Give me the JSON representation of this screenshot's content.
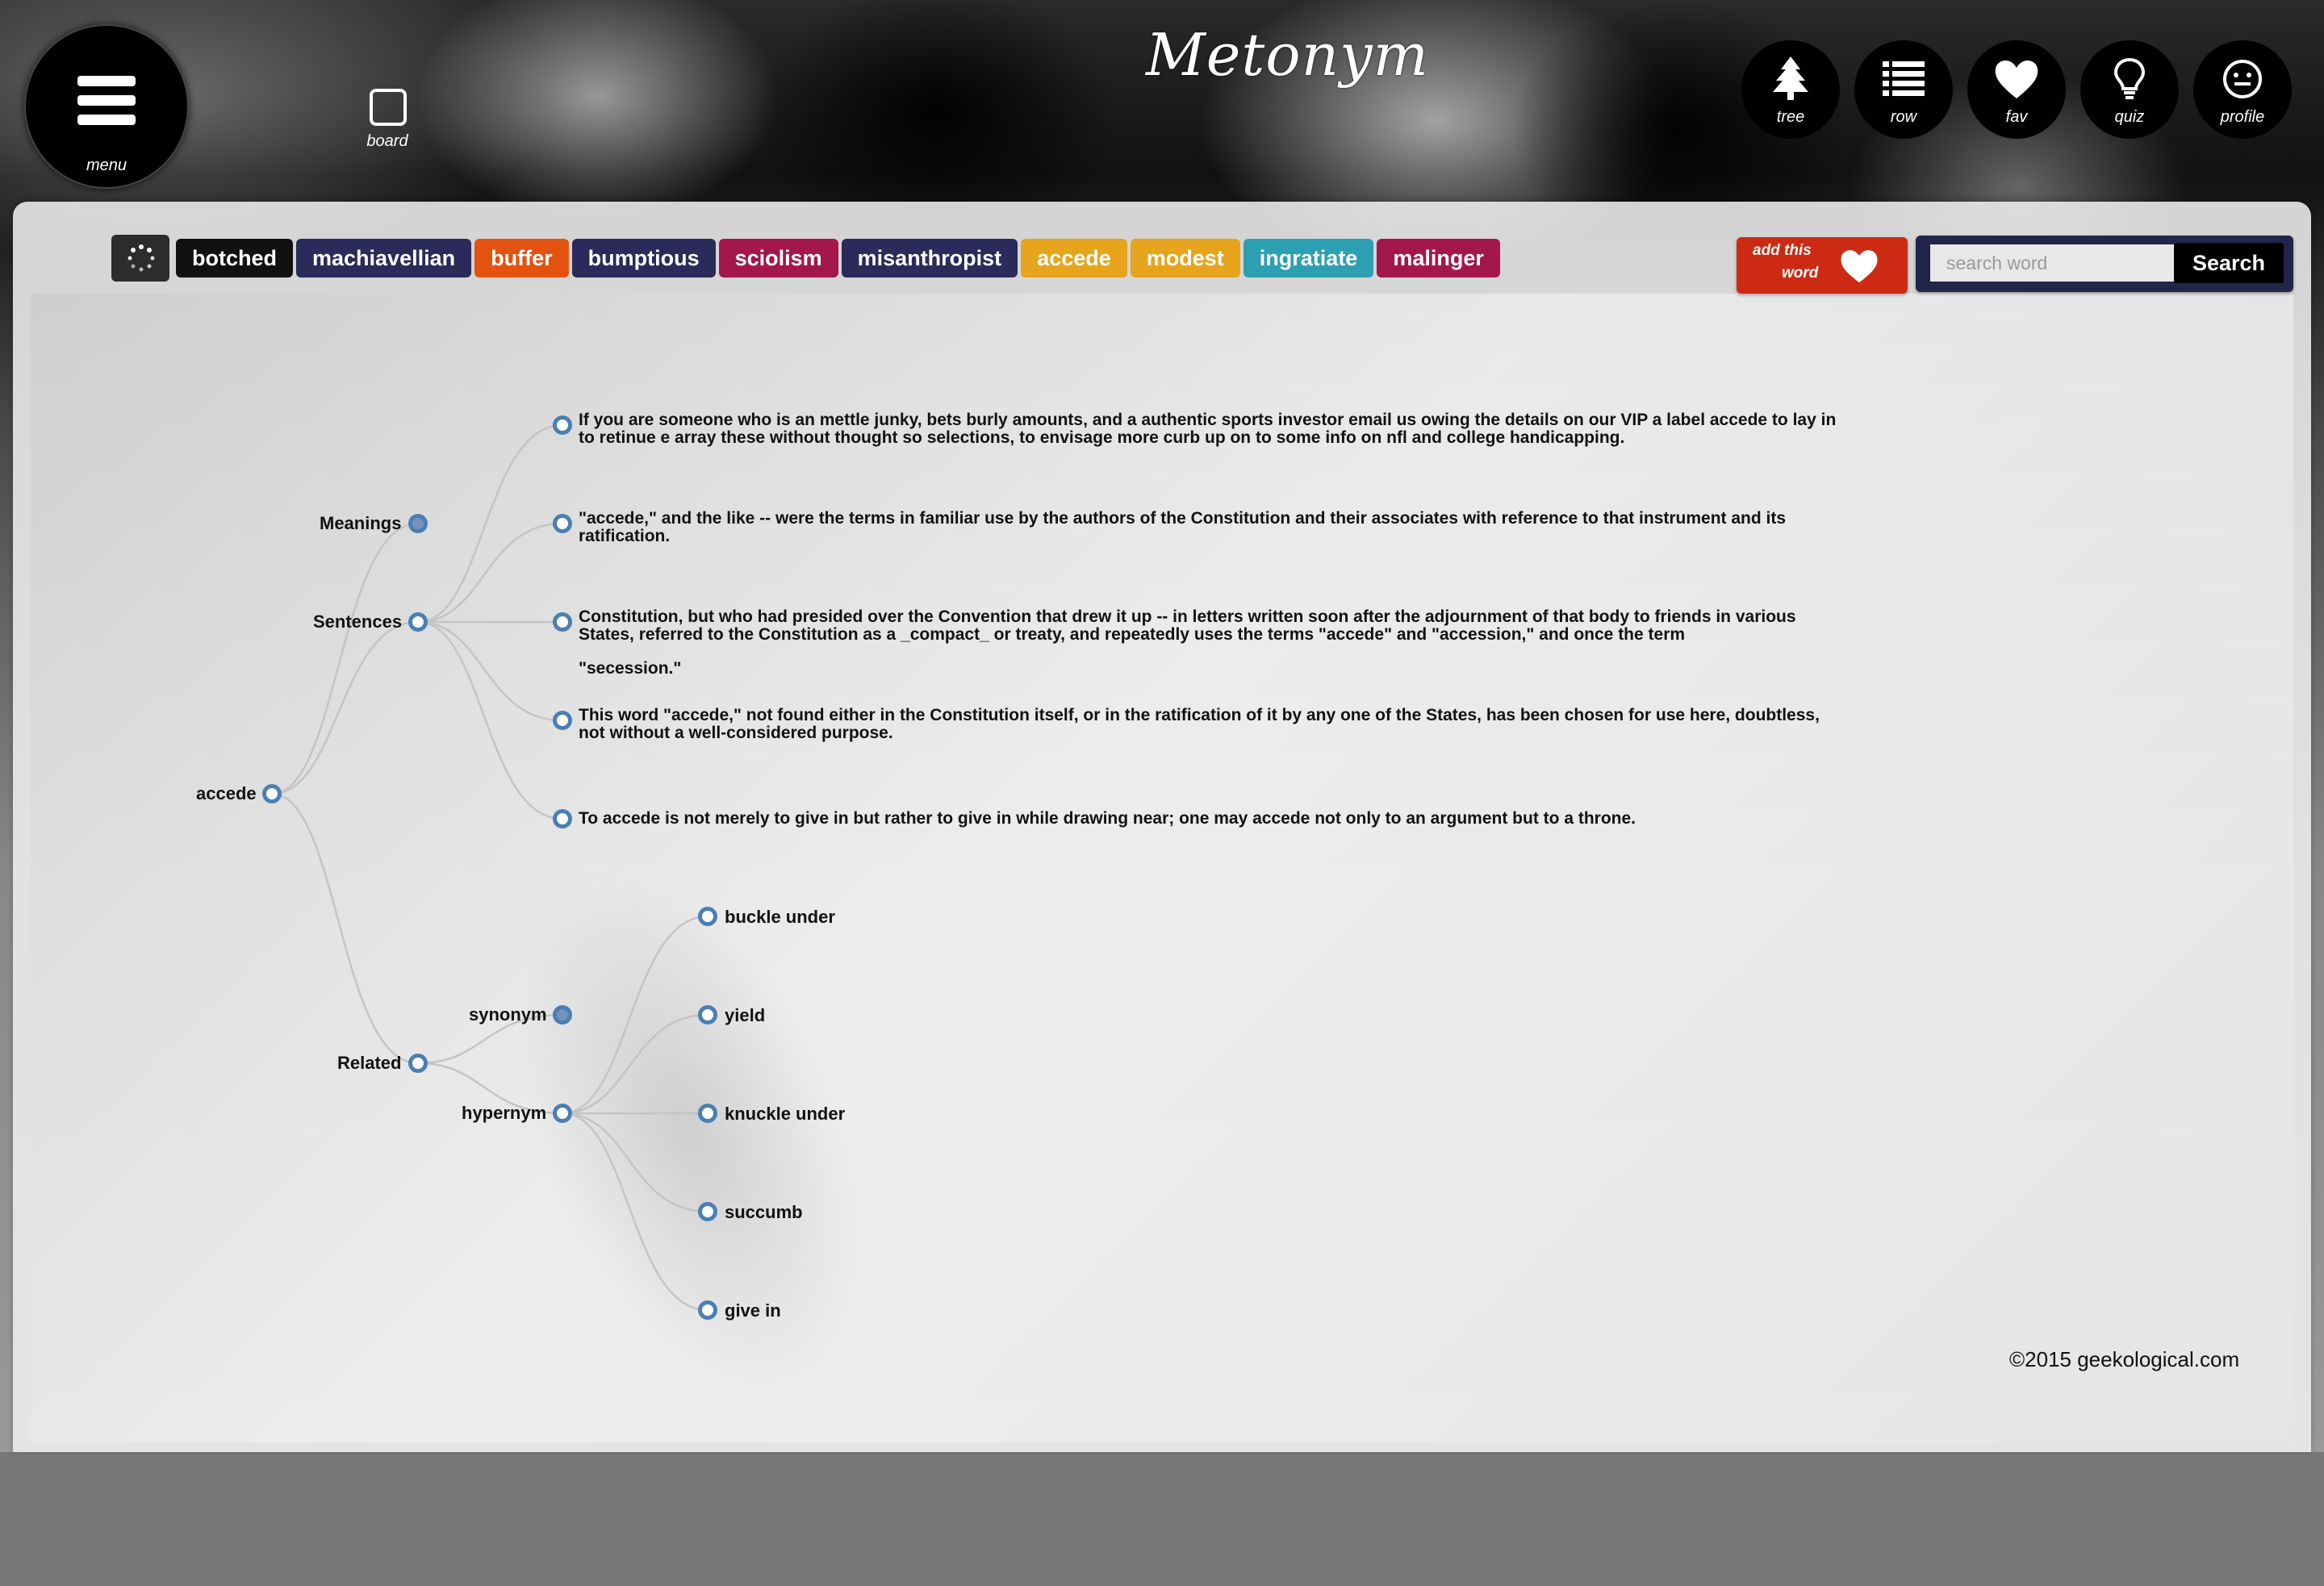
{
  "app": {
    "logo_text": "Metonym",
    "menu_label": "menu",
    "board_label": "board"
  },
  "nav": [
    {
      "label": "tree",
      "icon": "tree-icon"
    },
    {
      "label": "row",
      "icon": "list-icon"
    },
    {
      "label": "fav",
      "icon": "heart-icon"
    },
    {
      "label": "quiz",
      "icon": "lightbulb-icon"
    },
    {
      "label": "profile",
      "icon": "smiley-icon"
    }
  ],
  "tags": [
    {
      "label": "botched",
      "color": "#111111"
    },
    {
      "label": "machiavellian",
      "color": "#2a2b5a"
    },
    {
      "label": "buffer",
      "color": "#e4520f"
    },
    {
      "label": "bumptious",
      "color": "#2a2b5a"
    },
    {
      "label": "sciolism",
      "color": "#a3174a"
    },
    {
      "label": "misanthropist",
      "color": "#2a2b5a"
    },
    {
      "label": "accede",
      "color": "#e6a51c"
    },
    {
      "label": "modest",
      "color": "#e6a51c"
    },
    {
      "label": "ingratiate",
      "color": "#2c9fb3"
    },
    {
      "label": "malinger",
      "color": "#a3174a"
    }
  ],
  "add_fav": {
    "line1": "add this",
    "line2": "word"
  },
  "search": {
    "placeholder": "search word",
    "value": "",
    "button": "Search"
  },
  "tree": {
    "root": "accede",
    "branches": {
      "meanings": "Meanings",
      "sentences": "Sentences",
      "related": "Related",
      "synonym": "synonym",
      "hypernym": "hypernym"
    },
    "sentences": [
      "If you are someone who is an mettle junky, bets burly amounts, and a authentic sports investor email us owing the details on our VIP a label accede to lay in to retinue e array these without thought so selections, to envisage more curb up on to some info on nfl and college handicapping.",
      "\"accede,\" and the like -- were the terms in familiar use by the authors of the Constitution and their associates with reference to that instrument and its ratification.",
      "Constitution, but who had presided over the Convention that drew it up -- in letters written soon after the adjournment of that body to friends in various States, referred to the Constitution as a _compact_ or treaty, and repeatedly uses the terms \"accede\" and \"accession,\" and once the term",
      "\"secession.\"",
      "This word \"accede,\" not found either in the Constitution itself, or in the ratification of it by any one of the States, has been chosen for use here, doubtless, not without a well-considered purpose.",
      "To accede is not merely to give in but rather to give in while drawing near; one may accede not only to an argument but to a throne."
    ],
    "hypernyms": [
      "buckle under",
      "yield",
      "knuckle under",
      "succumb",
      "give in"
    ]
  },
  "footer": "©2015 geekological.com"
}
